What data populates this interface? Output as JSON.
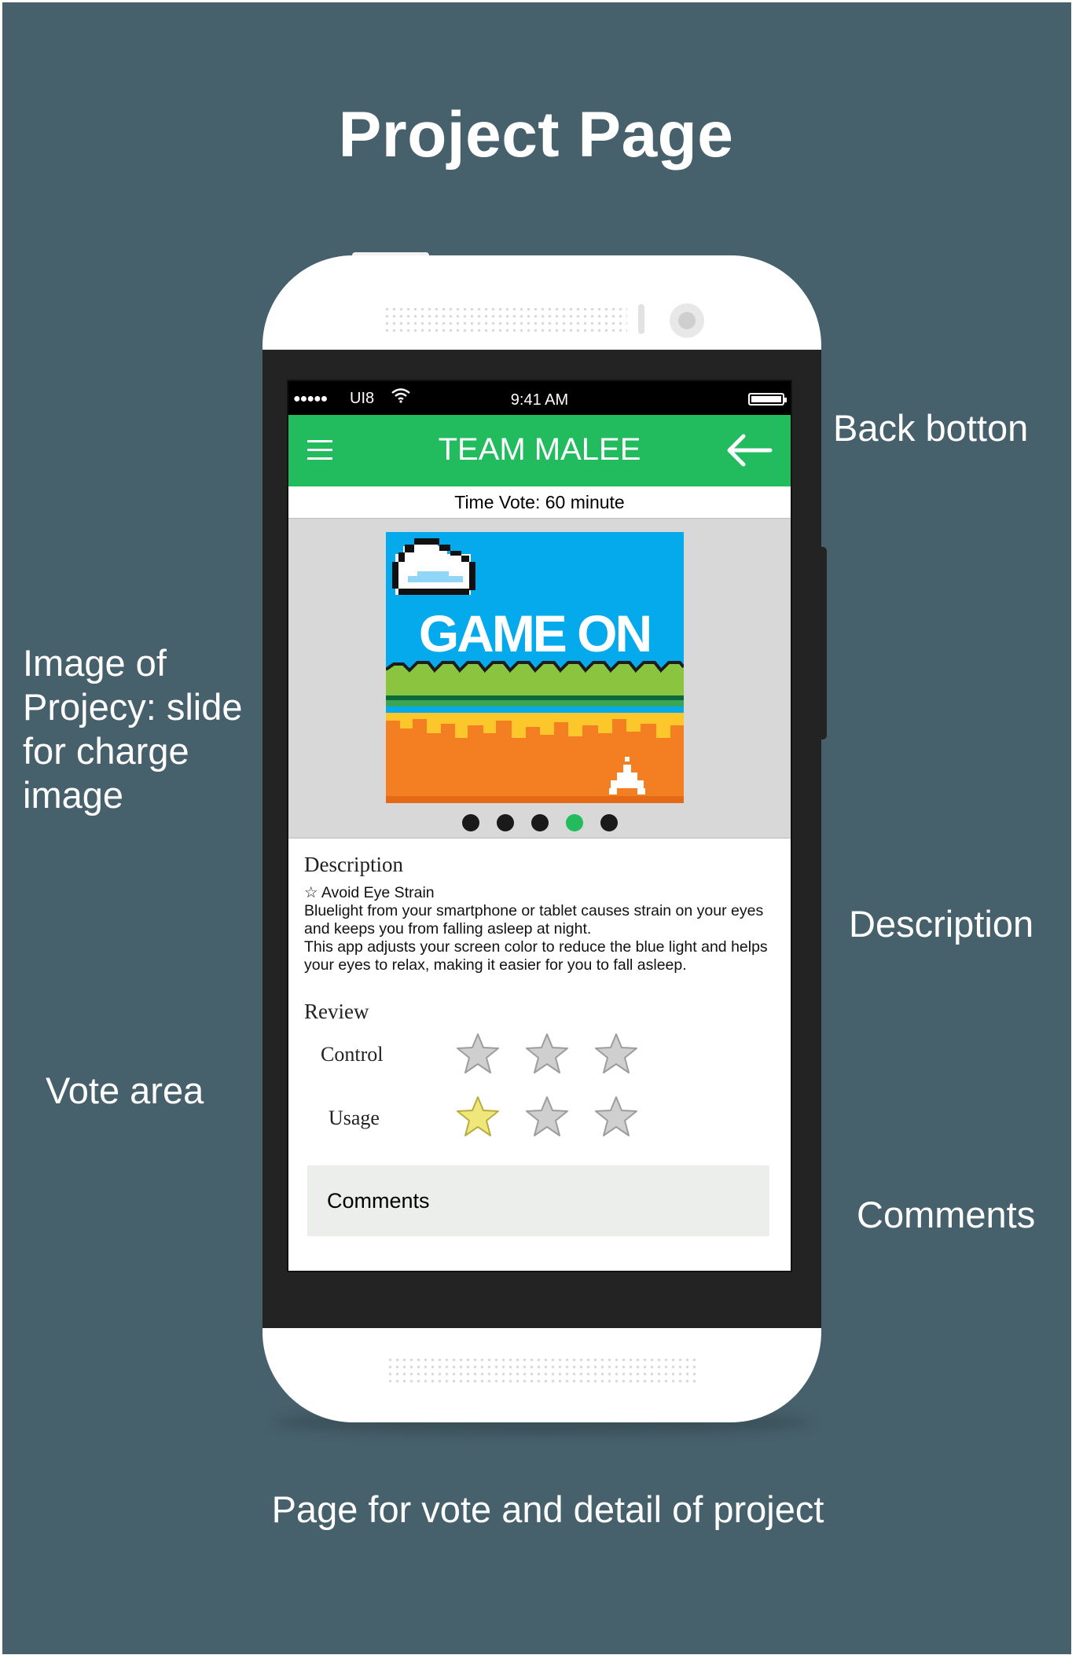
{
  "page": {
    "title": "Project Page",
    "caption": "Page for vote and detail of project"
  },
  "annotations": {
    "back_button": "Back botton",
    "image_area": [
      "Image of",
      "Projecy: slide",
      "for charge",
      "image"
    ],
    "description": "Description",
    "vote_area": "Vote area",
    "comments": "Comments"
  },
  "status_bar": {
    "signal": "●●●●●",
    "carrier": "UI8",
    "time": "9:41 AM"
  },
  "app_bar": {
    "title": "TEAM MALEE",
    "menu_icon": "hamburger-icon",
    "back_icon": "arrow-left-icon"
  },
  "time_vote": "Time Vote: 60 minute",
  "gallery": {
    "image_text": "GAME ON",
    "slide_count": 5,
    "active_slide": 4
  },
  "description": {
    "title": "Description",
    "lines": [
      "☆ Avoid Eye Strain",
      "Bluelight from your smartphone or tablet causes strain on your eyes",
      "and keeps you from falling asleep at night.",
      "This app adjusts your screen color to reduce the blue light and helps",
      "your eyes to relax, making it easier for you to fall asleep."
    ]
  },
  "review": {
    "title": "Review",
    "rows": [
      {
        "label": "Control",
        "rating": 0,
        "max": 3
      },
      {
        "label": "Usage",
        "rating": 1,
        "max": 3
      }
    ]
  },
  "comments": {
    "label": "Comments"
  },
  "colors": {
    "background": "#47616c",
    "accent_green": "#22bc5f",
    "star_filled": "#f0e77a",
    "star_empty": "#cfcfcf"
  }
}
